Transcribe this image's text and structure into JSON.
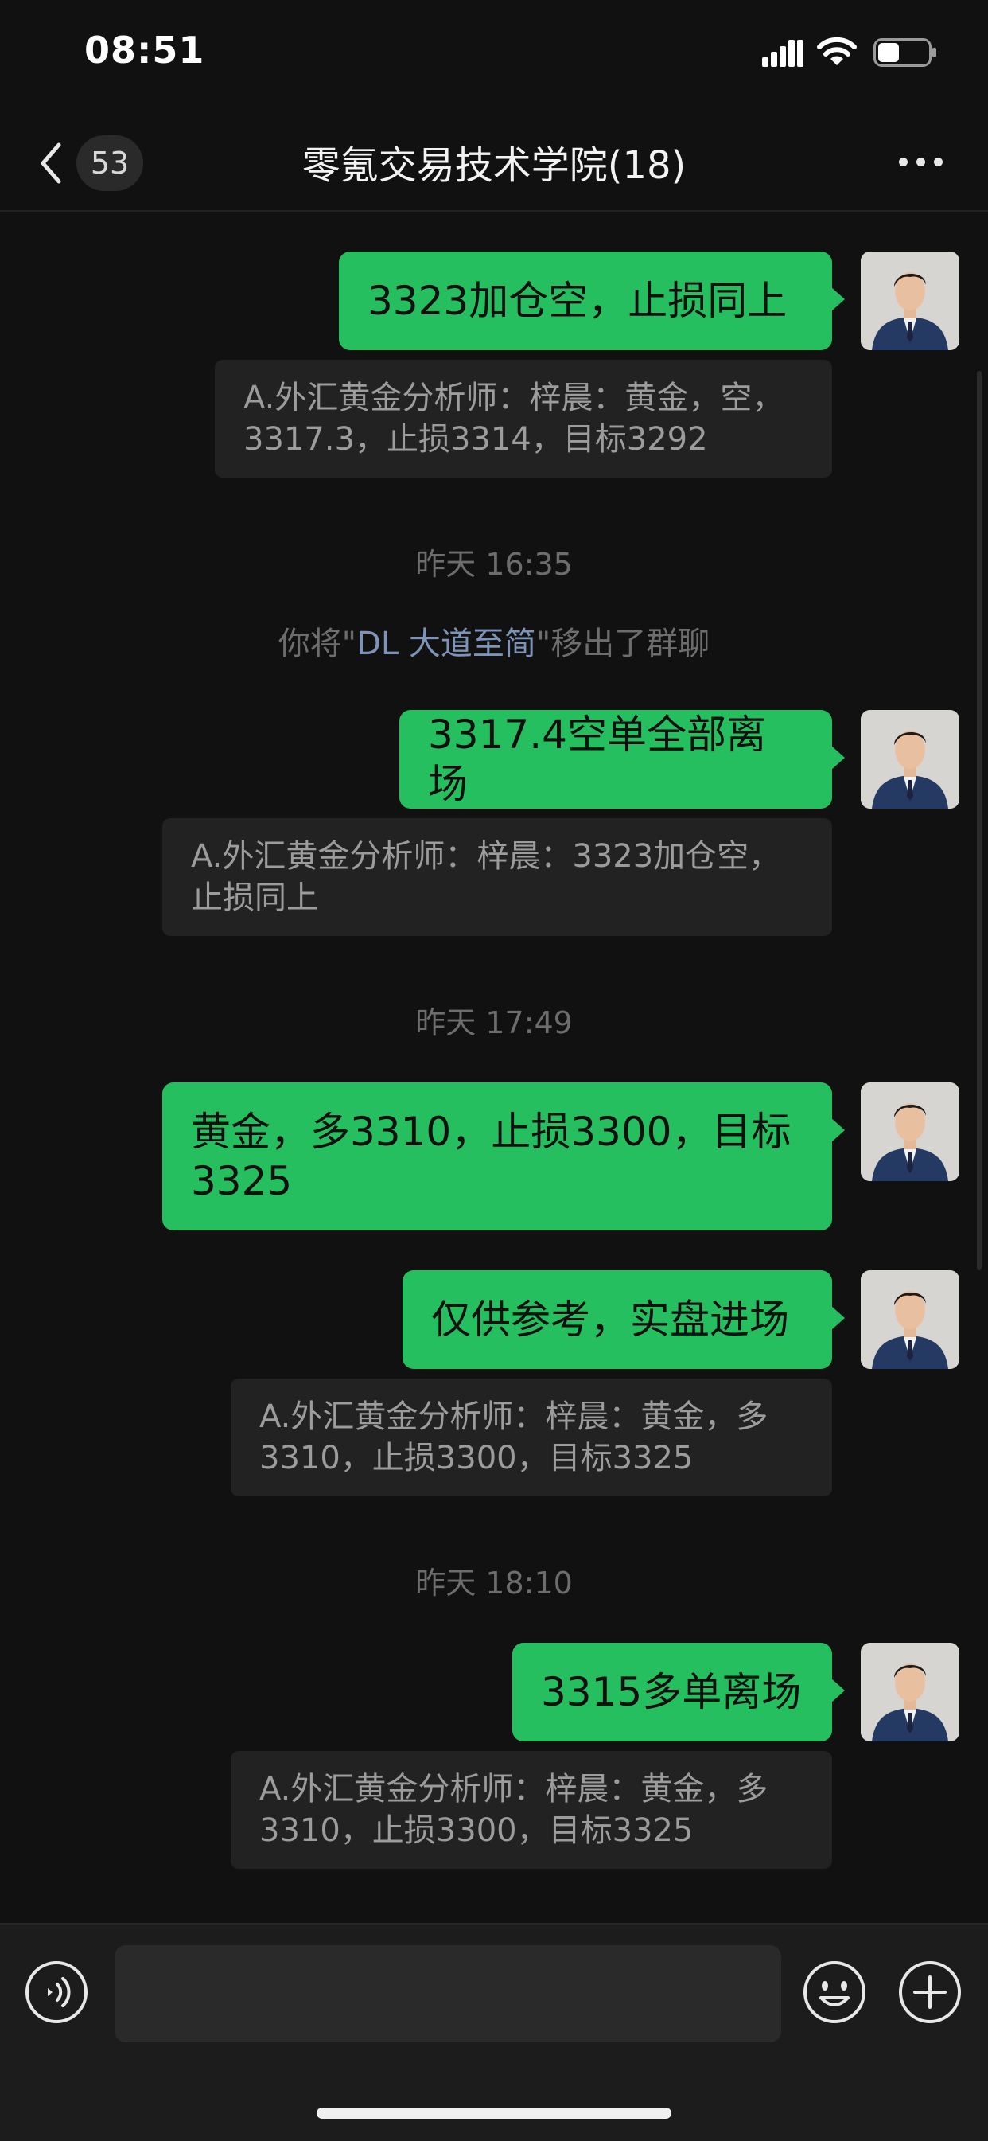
{
  "status_bar": {
    "time": "08:51"
  },
  "header": {
    "unread_count": "53",
    "title": "零氪交易技术学院(18)"
  },
  "messages": {
    "m1": {
      "text": "3323加仓空，止损同上",
      "quote": "A.外汇黄金分析师：梓晨：黄金，空，3317.3，止损3314，目标3292"
    },
    "t1": "昨天 16:35",
    "sys1": {
      "before": "你将\"",
      "name": "DL   大道至简",
      "after": "\"移出了群聊"
    },
    "m2": {
      "text": "3317.4空单全部离场",
      "quote": "A.外汇黄金分析师：梓晨：3323加仓空，止损同上"
    },
    "t2": "昨天 17:49",
    "m3": {
      "text": "黄金，多3310，止损3300，目标3325"
    },
    "m4": {
      "text": "仅供参考，实盘进场",
      "quote": "A.外汇黄金分析师：梓晨：黄金，多3310，止损3300，目标3325"
    },
    "t3": "昨天 18:10",
    "m5": {
      "text": "3315多单离场",
      "quote": "A.外汇黄金分析师：梓晨：黄金，多3310，止损3300，目标3325"
    }
  },
  "input": {
    "placeholder": ""
  },
  "icons": {
    "back": "chevron-left-icon",
    "more": "ellipsis-icon",
    "voice": "voice-icon",
    "emoji": "smiley-icon",
    "plus": "plus-circle-icon"
  },
  "colors": {
    "bubble": "#25bf5f",
    "background": "#111111",
    "quote_bg": "#222222"
  }
}
